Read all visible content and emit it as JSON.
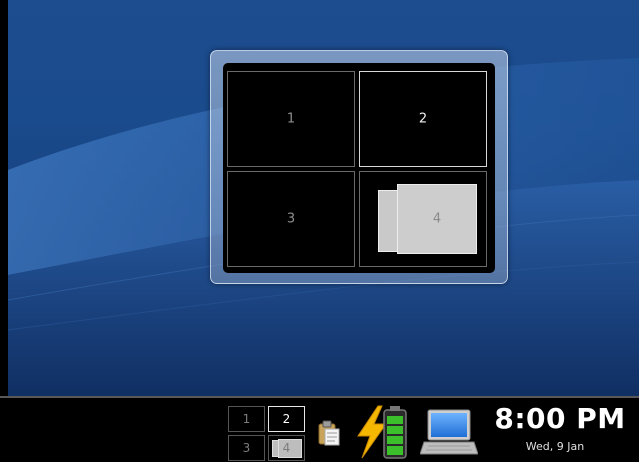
{
  "pager_popup": {
    "desktops": [
      {
        "label": "1",
        "active": false
      },
      {
        "label": "2",
        "active": true
      },
      {
        "label": "3",
        "active": false
      },
      {
        "label": "4",
        "active": false
      }
    ]
  },
  "taskbar": {
    "mini_pager": {
      "desktops": [
        "1",
        "2",
        "3",
        "4"
      ],
      "active_desktop": "2"
    },
    "tray_icons": [
      "clipboard-icon",
      "battery-charging-icon",
      "laptop-display-icon"
    ],
    "clock": {
      "time": "8:00 PM",
      "date": "Wed, 9 Jan"
    }
  },
  "colors": {
    "wallpaper": "#1a4b8c",
    "taskbar": "#000000",
    "battery_green": "#3bbf2a",
    "bolt": "#f5b700"
  }
}
